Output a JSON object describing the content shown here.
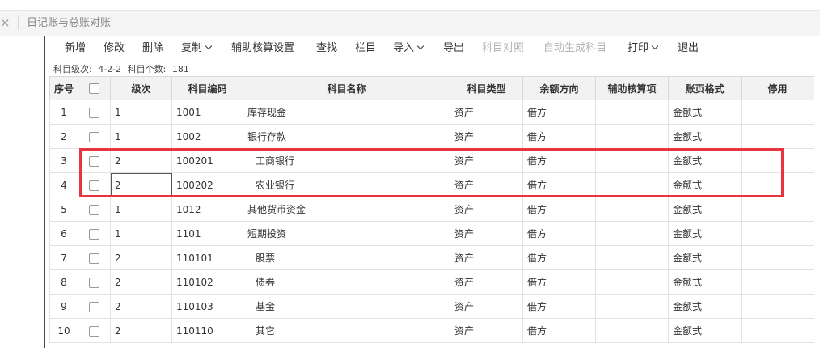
{
  "tab": {
    "close": "×",
    "title": "日记账与总账对账"
  },
  "toolbar": {
    "items": [
      {
        "label": "新增",
        "disabled": false,
        "dropdown": false
      },
      {
        "label": "修改",
        "disabled": false,
        "dropdown": false
      },
      {
        "label": "删除",
        "disabled": false,
        "dropdown": false
      },
      {
        "label": "复制",
        "disabled": false,
        "dropdown": true
      },
      {
        "label": "辅助核算设置",
        "disabled": false,
        "dropdown": false
      },
      {
        "label": "查找",
        "disabled": false,
        "dropdown": false
      },
      {
        "label": "栏目",
        "disabled": false,
        "dropdown": false
      },
      {
        "label": "导入",
        "disabled": false,
        "dropdown": true
      },
      {
        "label": "导出",
        "disabled": false,
        "dropdown": false
      },
      {
        "label": "科目对照",
        "disabled": true,
        "dropdown": false
      },
      {
        "label": "自动生成科目",
        "disabled": true,
        "dropdown": false
      },
      {
        "label": "打印",
        "disabled": false,
        "dropdown": true
      },
      {
        "label": "退出",
        "disabled": false,
        "dropdown": false
      }
    ]
  },
  "info": {
    "level_label": "科目级次:",
    "level_value": "4-2-2",
    "count_label": "科目个数:",
    "count_value": "181"
  },
  "table": {
    "headers": [
      "序号",
      "",
      "级次",
      "科目编码",
      "科目名称",
      "科目类型",
      "余额方向",
      "辅助核算项",
      "账页格式",
      "停用"
    ],
    "rows": [
      {
        "no": "1",
        "level": "1",
        "code": "1001",
        "name": "库存现金",
        "type": "资产",
        "direction": "借方",
        "aux": "",
        "format": "金额式",
        "disabled": ""
      },
      {
        "no": "2",
        "level": "1",
        "code": "1002",
        "name": "银行存款",
        "type": "资产",
        "direction": "借方",
        "aux": "",
        "format": "金额式",
        "disabled": ""
      },
      {
        "no": "3",
        "level": "2",
        "code": "100201",
        "name": "工商银行",
        "type": "资产",
        "direction": "借方",
        "aux": "",
        "format": "金额式",
        "disabled": ""
      },
      {
        "no": "4",
        "level": "2",
        "code": "100202",
        "name": "农业银行",
        "type": "资产",
        "direction": "借方",
        "aux": "",
        "format": "金额式",
        "disabled": ""
      },
      {
        "no": "5",
        "level": "1",
        "code": "1012",
        "name": "其他货币资金",
        "type": "资产",
        "direction": "借方",
        "aux": "",
        "format": "金额式",
        "disabled": ""
      },
      {
        "no": "6",
        "level": "1",
        "code": "1101",
        "name": "短期投资",
        "type": "资产",
        "direction": "借方",
        "aux": "",
        "format": "金额式",
        "disabled": ""
      },
      {
        "no": "7",
        "level": "2",
        "code": "110101",
        "name": "股票",
        "type": "资产",
        "direction": "借方",
        "aux": "",
        "format": "金额式",
        "disabled": ""
      },
      {
        "no": "8",
        "level": "2",
        "code": "110102",
        "name": "债券",
        "type": "资产",
        "direction": "借方",
        "aux": "",
        "format": "金额式",
        "disabled": ""
      },
      {
        "no": "9",
        "level": "2",
        "code": "110103",
        "name": "基金",
        "type": "资产",
        "direction": "借方",
        "aux": "",
        "format": "金额式",
        "disabled": ""
      },
      {
        "no": "10",
        "level": "2",
        "code": "110110",
        "name": "其它",
        "type": "资产",
        "direction": "借方",
        "aux": "",
        "format": "金额式",
        "disabled": ""
      }
    ]
  },
  "colors": {
    "highlight_box": "#e8343f",
    "disabled_text": "#b5b5b5"
  }
}
